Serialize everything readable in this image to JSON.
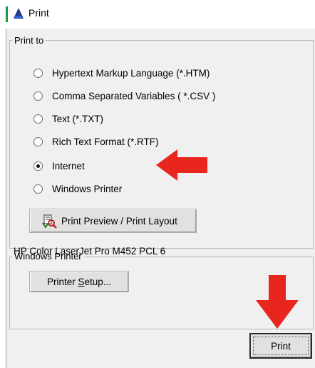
{
  "window": {
    "title": "Print",
    "icon": "printer-app-icon"
  },
  "print_to": {
    "group_label": "Print to",
    "options": [
      {
        "label": "Hypertext Markup Language (*.HTM)",
        "checked": false
      },
      {
        "label": "Comma Separated Variables ( *.CSV )",
        "checked": false
      },
      {
        "label": "Text (*.TXT)",
        "checked": false
      },
      {
        "label": "Rich Text Format (*.RTF)",
        "checked": false
      },
      {
        "label": "Internet",
        "checked": true
      },
      {
        "label": "Windows Printer",
        "checked": false
      }
    ],
    "preview_button_label": "Print Preview / Print Layout",
    "preview_button_icon": "print-preview-icon"
  },
  "windows_printer": {
    "group_label": "Windows Printer",
    "printer_name": "HP Color LaserJet Pro M452 PCL 6",
    "setup_button_prefix": "Printer ",
    "setup_button_mnemonic": "S",
    "setup_button_suffix": "etup..."
  },
  "footer": {
    "print_button_label": "Print"
  },
  "annotations": {
    "arrow_color": "#e8261e",
    "arrow_icons": [
      "red-left-arrow-icon",
      "red-down-arrow-icon"
    ]
  }
}
